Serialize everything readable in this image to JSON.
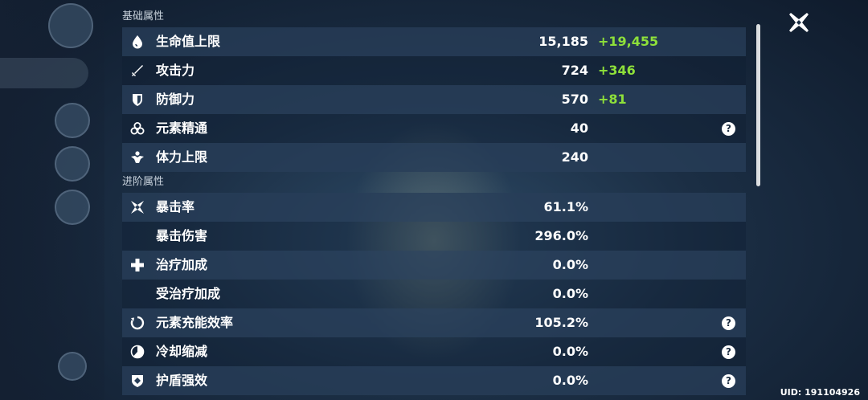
{
  "sections": {
    "basic_title": "基础属性",
    "advanced_title": "进阶属性"
  },
  "basic_stats": [
    {
      "label": "生命值上限",
      "value": "15,185",
      "bonus": "+19,455",
      "icon": "hp-droplet-icon"
    },
    {
      "label": "攻击力",
      "value": "724",
      "bonus": "+346",
      "icon": "sword-icon"
    },
    {
      "label": "防御力",
      "value": "570",
      "bonus": "+81",
      "icon": "shield-icon"
    },
    {
      "label": "元素精通",
      "value": "40",
      "icon": "elemental-mastery-icon",
      "help": "?"
    },
    {
      "label": "体力上限",
      "value": "240",
      "icon": "stamina-icon"
    }
  ],
  "advanced_stats": [
    {
      "label": "暴击率",
      "value": "61.1%",
      "icon": "crit-star-icon"
    },
    {
      "label": "暴击伤害",
      "value": "296.0%"
    },
    {
      "label": "治疗加成",
      "value": "0.0%",
      "icon": "healing-cross-icon"
    },
    {
      "label": "受治疗加成",
      "value": "0.0%"
    },
    {
      "label": "元素充能效率",
      "value": "105.2%",
      "icon": "energy-recharge-icon",
      "help": "?"
    },
    {
      "label": "冷却缩减",
      "value": "0.0%",
      "icon": "cooldown-icon",
      "help": "?"
    },
    {
      "label": "护盾强效",
      "value": "0.0%",
      "icon": "shield-strength-icon",
      "help": "?"
    }
  ],
  "uid": "UID: 191104926",
  "colors": {
    "bonus": "#8ee03a",
    "row_shade": "#283e58",
    "text": "#ffffff"
  }
}
